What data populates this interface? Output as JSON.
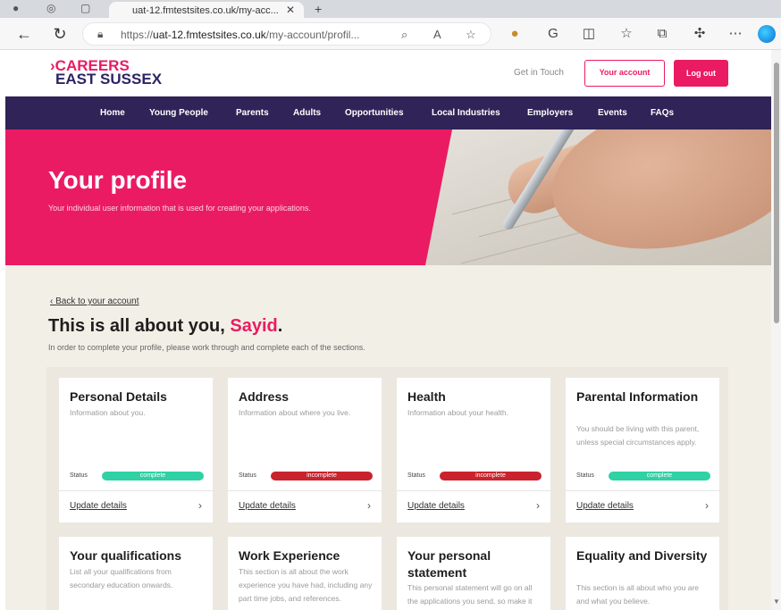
{
  "browser": {
    "tab_title": "uat-12.fmtestsites.co.uk/my-acc...",
    "url_prefix": "https://",
    "url_host": "uat-12.fmtestsites.co.uk",
    "url_path": "/my-account/profil...",
    "icons": [
      "back-arrow",
      "refresh",
      "lock",
      "zoom",
      "read-aloud",
      "favorite-star",
      "extension",
      "profile-g",
      "split-screen",
      "favorites",
      "collections",
      "extensions-puzzle",
      "more",
      "edge-copilot"
    ]
  },
  "header": {
    "logo_line1": "CAREERS",
    "logo_line2": "EAST SUSSEX",
    "logo_mark": "›",
    "get_in_touch": "Get in Touch",
    "account_button": "Your account",
    "logout_button": "Log out"
  },
  "nav": {
    "items": [
      "Home",
      "Young People",
      "Parents",
      "Adults",
      "Opportunities",
      "Local Industries",
      "Employers",
      "Events",
      "FAQs"
    ]
  },
  "hero": {
    "title": "Your profile",
    "subtitle": "Your individual user information that is used for creating your applications."
  },
  "profile": {
    "back_link": "Back to your account",
    "headline_prefix": "This is all about you, ",
    "user_name": "Sayid",
    "headline_suffix": ".",
    "intro": "In order to complete your profile, please work through and complete each of the sections."
  },
  "cards": [
    {
      "title": "Personal Details",
      "desc": "Information about you.",
      "status_label": "Status",
      "status": "complete",
      "status_text": "complete",
      "link": "Update details"
    },
    {
      "title": "Address",
      "desc": "Information about where you live.",
      "status_label": "Status",
      "status": "incomplete",
      "status_text": "incomplete",
      "link": "Update details"
    },
    {
      "title": "Health",
      "desc": "Information about your health.",
      "status_label": "Status",
      "status": "incomplete",
      "status_text": "incomplete",
      "link": "Update details"
    },
    {
      "title": "Parental Information",
      "desc": "You should be living with this parent, unless special circumstances apply.",
      "status_label": "Status",
      "status": "complete",
      "status_text": "complete",
      "link": "Update details"
    },
    {
      "title": "Your qualifications",
      "desc": "List all your qualifications from secondary education onwards."
    },
    {
      "title": "Work Experience",
      "desc": "This section is all about the work experience you have had, including any part time jobs, and references."
    },
    {
      "title": "Your personal statement",
      "desc": "This personal statement will go on all the applications you send, so make it about you and"
    },
    {
      "title": "Equality and Diversity",
      "desc": "This section is all about who you are and what you believe."
    }
  ],
  "colors": {
    "brand_pink": "#ea1b63",
    "nav_purple": "#2f2357",
    "complete_green": "#2fd1a5",
    "incomplete_red": "#c9232e",
    "page_beige": "#f2efe6"
  }
}
